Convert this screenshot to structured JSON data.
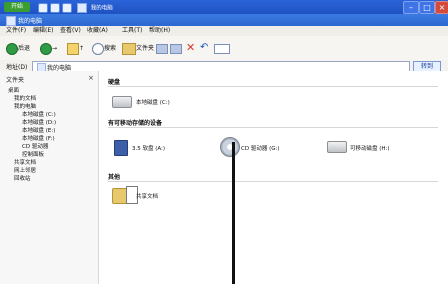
{
  "taskbar": {
    "start_label": "开始",
    "window_label": "我的电脑",
    "controls": {
      "minimize": "–",
      "maximize": "□",
      "close": "×"
    }
  },
  "window": {
    "title": "我的电脑"
  },
  "menubar": {
    "items": [
      "文件(F)",
      "编辑(E)",
      "查看(V)",
      "收藏(A)",
      "工具(T)",
      "帮助(H)"
    ]
  },
  "toolbar": {
    "back": "后退",
    "forward": "→",
    "up": "↑",
    "search": "搜索",
    "folders": "文件夹",
    "icons": [
      "移动",
      "复制",
      "删除",
      "撤消",
      "视图"
    ]
  },
  "addressbar": {
    "label": "地址(D)",
    "value": "我的电脑",
    "go": "转到"
  },
  "nav": {
    "title": "文件夹",
    "items": [
      "桌面",
      "我的文档",
      "我的电脑",
      "本地磁盘 (C:)",
      "本地磁盘 (D:)",
      "本地磁盘 (E:)",
      "本地磁盘 (F:)",
      "CD 驱动器",
      "控制面板",
      "共享文档",
      "网上邻居",
      "回收站"
    ]
  },
  "content": {
    "section1": "硬盘",
    "drive_c": "本地磁盘 (C:)",
    "section2": "有可移动存储的设备",
    "floppy": "3.5 软盘 (A:)",
    "cd": "CD 驱动器 (G:)",
    "drive_e": "可移动磁盘 (H:)",
    "section3": "其他",
    "control_panel": "共享文档"
  }
}
